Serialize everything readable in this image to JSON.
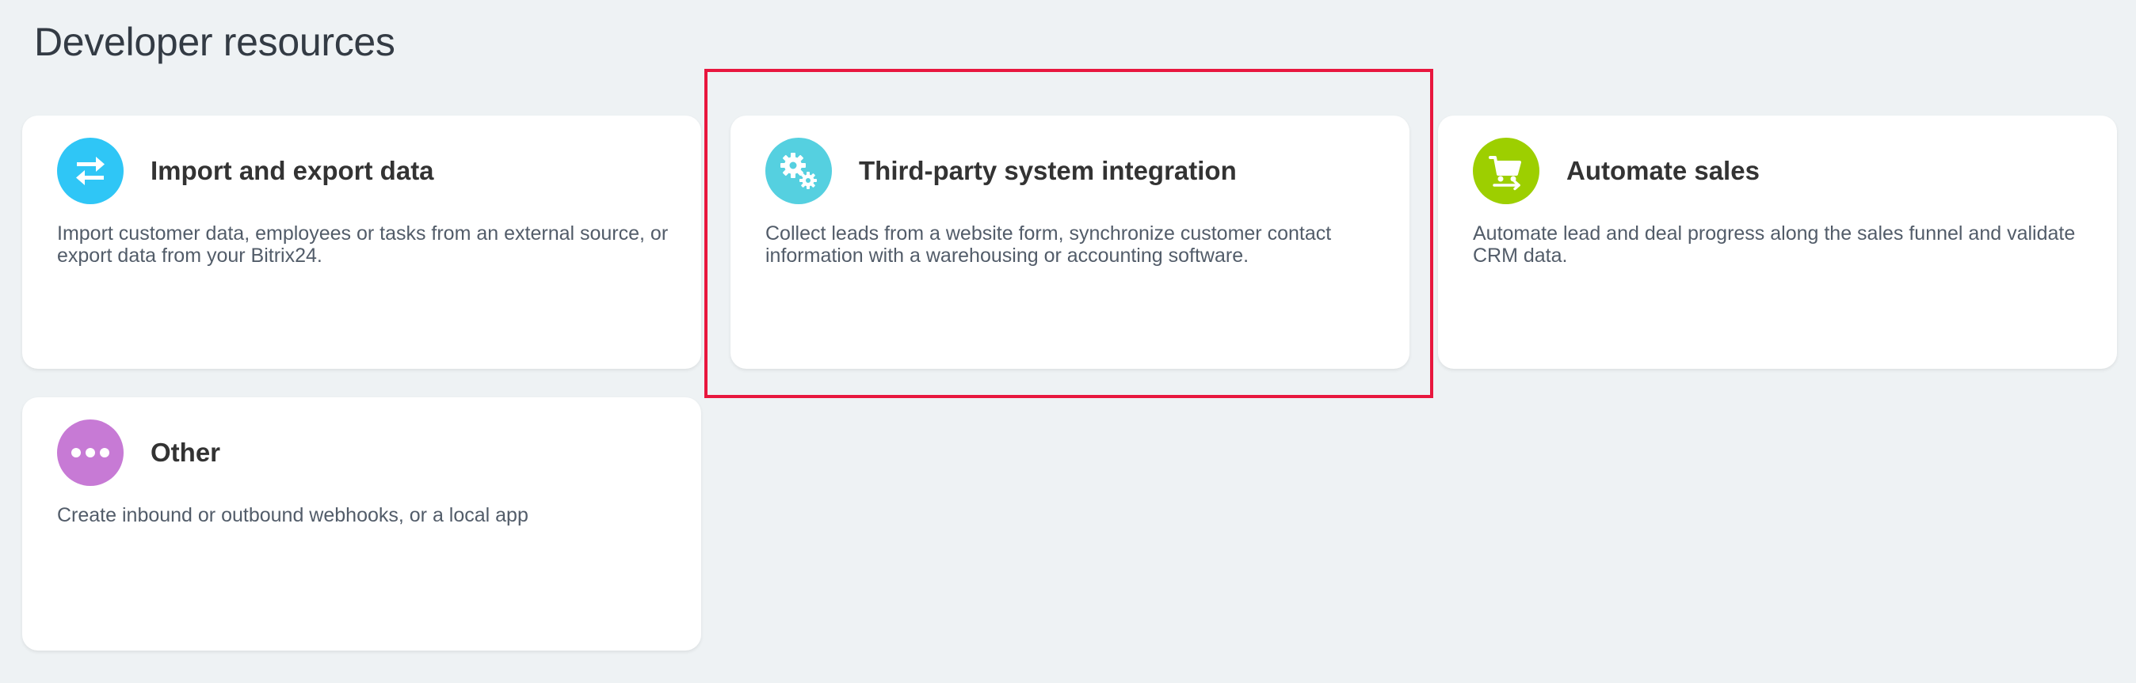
{
  "page": {
    "title": "Developer resources"
  },
  "cards": [
    {
      "title": "Import and export data",
      "description": "Import customer data, employees or tasks from an external source, or export data from your Bitrix24.",
      "icon": "arrows-exchange-icon",
      "icon_color": "#2fc6f6"
    },
    {
      "title": "Third-party system integration",
      "description": "Collect leads from a website form, synchronize customer contact information with a warehousing or accounting software.",
      "icon": "gears-icon",
      "icon_color": "#55d0e0"
    },
    {
      "title": "Automate sales",
      "description": "Automate lead and deal progress along the sales funnel and validate CRM data.",
      "icon": "cart-icon",
      "icon_color": "#9dcf00"
    },
    {
      "title": "Other",
      "description": "Create inbound or outbound webhooks, or a local app",
      "icon": "more-dots-icon",
      "icon_color": "#c77ad5"
    }
  ],
  "highlight": {
    "color": "#e8173e",
    "target": "Third-party system integration"
  }
}
